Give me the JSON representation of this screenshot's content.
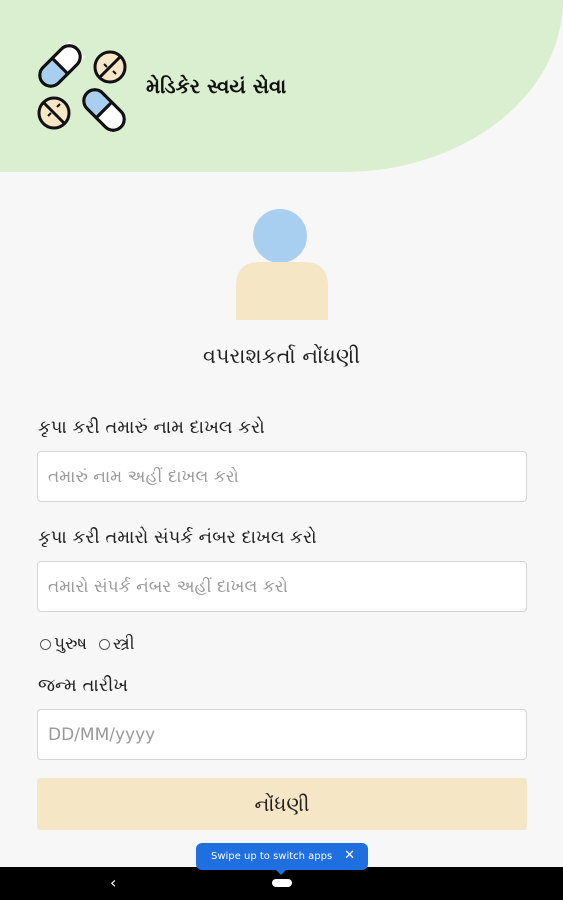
{
  "header": {
    "app_title": "મેડિકેર સ્વયં સેવા",
    "logo_icon": "pills-icon",
    "background_color": "#d9efcf"
  },
  "form": {
    "title": "વપરાશકર્તા નોંધણી",
    "avatar_icon": "user-avatar-icon",
    "name_label": "કૃપા કરી તમારું નામ દાખલ કરો",
    "name_placeholder": "તમારું નામ અહીં દાખલ કરો",
    "name_value": "",
    "contact_label": "કૃપા કરી તમારો સંપર્ક નંબર દાખલ કરો",
    "contact_placeholder": "તમારો સંપર્ક નંબર અહીં દાખલ કરો",
    "contact_value": "",
    "gender_options": [
      "પુરુષ",
      "સ્ત્રી"
    ],
    "dob_label": "જન્મ તારીખ",
    "dob_placeholder": "DD/MM/yyyy",
    "dob_value": "",
    "submit_label": "નોંધણી",
    "submit_color": "#f5e6c6"
  },
  "system": {
    "toast_text": "Swipe up to switch apps",
    "toast_close": "✕",
    "back_glyph": "‹",
    "toast_color": "#1f6fe0"
  }
}
